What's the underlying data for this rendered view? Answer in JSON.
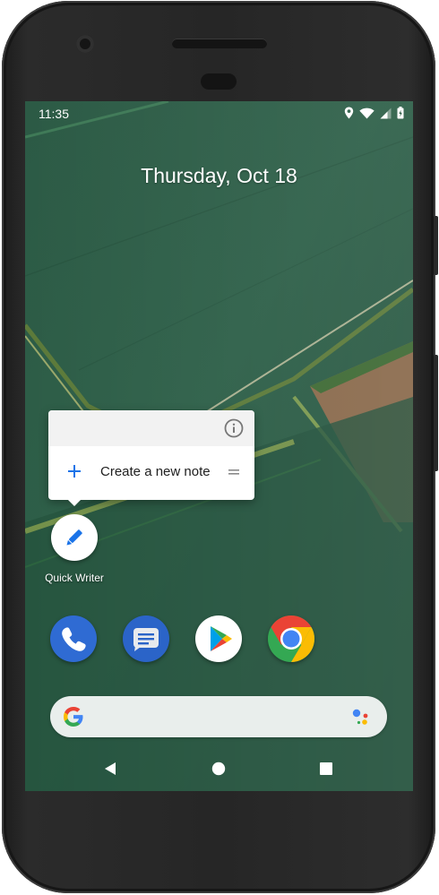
{
  "status_bar": {
    "time": "11:35",
    "icons": [
      "location-icon",
      "wifi-icon",
      "signal-icon",
      "battery-icon"
    ]
  },
  "home": {
    "date": "Thursday, Oct 18"
  },
  "shortcut_popup": {
    "info_icon": "info-icon",
    "item_icon": "plus-icon",
    "item_label": "Create a new note",
    "drag_icon": "drag-handle-icon"
  },
  "app": {
    "name": "Quick Writer",
    "icon": "pencil-icon"
  },
  "dock": {
    "apps": [
      "phone-icon",
      "messages-icon",
      "play-store-icon",
      "chrome-icon"
    ]
  },
  "search": {
    "left_icon": "google-g-icon",
    "right_icon": "assistant-icon"
  },
  "nav": {
    "back": "back-icon",
    "home": "home-icon",
    "recents": "recents-icon"
  },
  "colors": {
    "accent_blue": "#1a73e8",
    "wallpaper_green": "#2b5a44",
    "phone_blue": "#2f6bd3",
    "messages_blue": "#2b64c8"
  }
}
